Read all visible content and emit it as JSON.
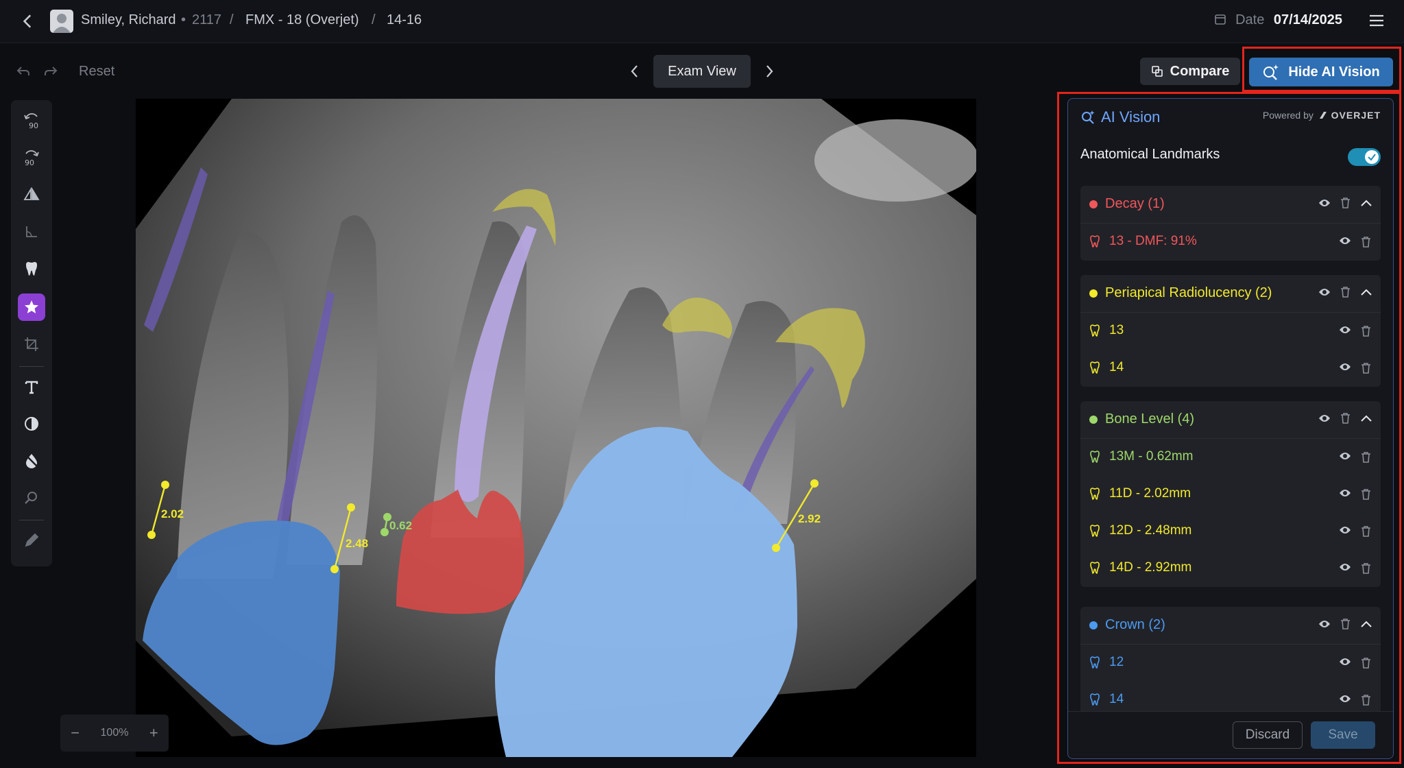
{
  "header": {
    "patient_name": "Smiley, Richard",
    "patient_id": "2117",
    "sep": "•",
    "slash": "/",
    "series": "FMX - 18 (Overjet)",
    "teeth": "14-16",
    "date_label": "Date",
    "date_value": "07/14/2025"
  },
  "toolbar": {
    "reset_label": "Reset",
    "view_label": "Exam View",
    "compare_label": "Compare",
    "hide_ai_label": "Hide AI Vision"
  },
  "zoom": {
    "minus": "−",
    "level": "100%",
    "plus": "+"
  },
  "tools": {
    "rotate_left_label": "90",
    "rotate_right_label": "90"
  },
  "image_labels": {
    "m1": "2.02",
    "m2": "2.48",
    "m3": "0.62",
    "m4": "2.92"
  },
  "panel": {
    "title": "AI Vision",
    "powered_by": "Powered by",
    "brand": "OVERJET",
    "landmarks_label": "Anatomical Landmarks",
    "landmarks_on": true,
    "groups": [
      {
        "title": "Decay (1)",
        "color": "#f0575a",
        "items": [
          "13 - DMF: 91%"
        ]
      },
      {
        "title": "Periapical Radiolucency (2)",
        "color": "#f2ea2c",
        "items": [
          "13",
          "14"
        ]
      },
      {
        "title": "Bone Level (4)",
        "color": "#9fd86a",
        "items": [
          "13M - 0.62mm",
          "11D - 2.02mm",
          "12D - 2.48mm",
          "14D - 2.92mm"
        ],
        "item_colors": [
          "#9fd86a",
          "#f2ea2c",
          "#f2ea2c",
          "#f2ea2c"
        ]
      },
      {
        "title": "Crown (2)",
        "color": "#4c9bf0",
        "items": [
          "12",
          "14"
        ]
      }
    ],
    "discard_label": "Discard",
    "save_label": "Save"
  },
  "colors": {
    "accent": "#2f6fb4",
    "highlight_box": "#e3251c",
    "decay": "#f0575a",
    "periapical": "#f2ea2c",
    "bone": "#9fd86a",
    "crown": "#4c9bf0"
  }
}
